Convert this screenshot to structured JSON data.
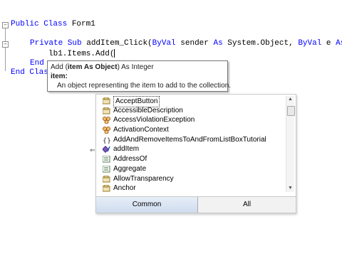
{
  "code": {
    "line1_kw": "Public Class",
    "line1_rest": " Form1",
    "line2_kw1": "Private Sub",
    "line2_rest1": " addItem_Click(",
    "line2_kw2": "ByVal",
    "line2_rest2": " sender ",
    "line2_kw3": "As",
    "line2_rest3": " System.Object, ",
    "line2_kw4": "ByVal",
    "line2_rest4": " e ",
    "line2_kw5": "As",
    "line3": "lb1.Items.Add(",
    "line4_kw": "End",
    "line5_kw": "End Clas"
  },
  "tooltip": {
    "sig_prefix": "Add (",
    "sig_param": "item As Object",
    "sig_suffix": ") As Integer",
    "param_name": "item:",
    "param_desc": "An object representing the item to add to the collection."
  },
  "completion": {
    "items": [
      {
        "label": "AcceptButton",
        "icon": "property-icon"
      },
      {
        "label": "AccessibleDescription",
        "icon": "property-icon"
      },
      {
        "label": "AccessViolationException",
        "icon": "class-icon"
      },
      {
        "label": "ActivationContext",
        "icon": "class-icon"
      },
      {
        "label": "AddAndRemoveItemsToAndFromListBoxTutorial",
        "icon": "namespace-icon"
      },
      {
        "label": "addItem",
        "icon": "field-icon"
      },
      {
        "label": "AddressOf",
        "icon": "keyword-icon"
      },
      {
        "label": "Aggregate",
        "icon": "keyword-icon"
      },
      {
        "label": "AllowTransparency",
        "icon": "property-icon"
      },
      {
        "label": "Anchor",
        "icon": "property-icon"
      }
    ],
    "tabs": {
      "common": "Common",
      "all": "All"
    }
  }
}
